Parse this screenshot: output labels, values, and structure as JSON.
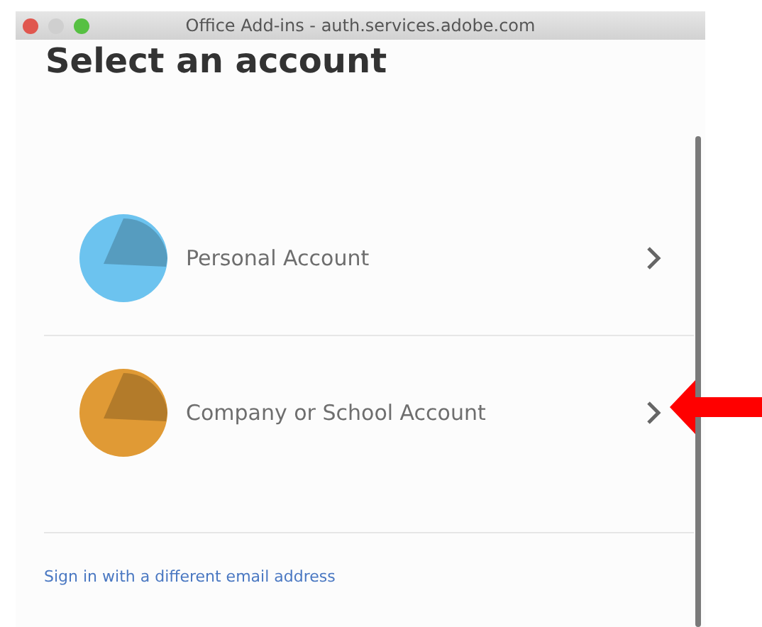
{
  "window": {
    "title": "Office Add-ins - auth.services.adobe.com"
  },
  "heading": "Select an account",
  "accounts": [
    {
      "label": "Personal Account",
      "color": "#6cc3ef"
    },
    {
      "label": "Company or School Account",
      "color": "#e09a35"
    }
  ],
  "link": "Sign in with a different email address"
}
